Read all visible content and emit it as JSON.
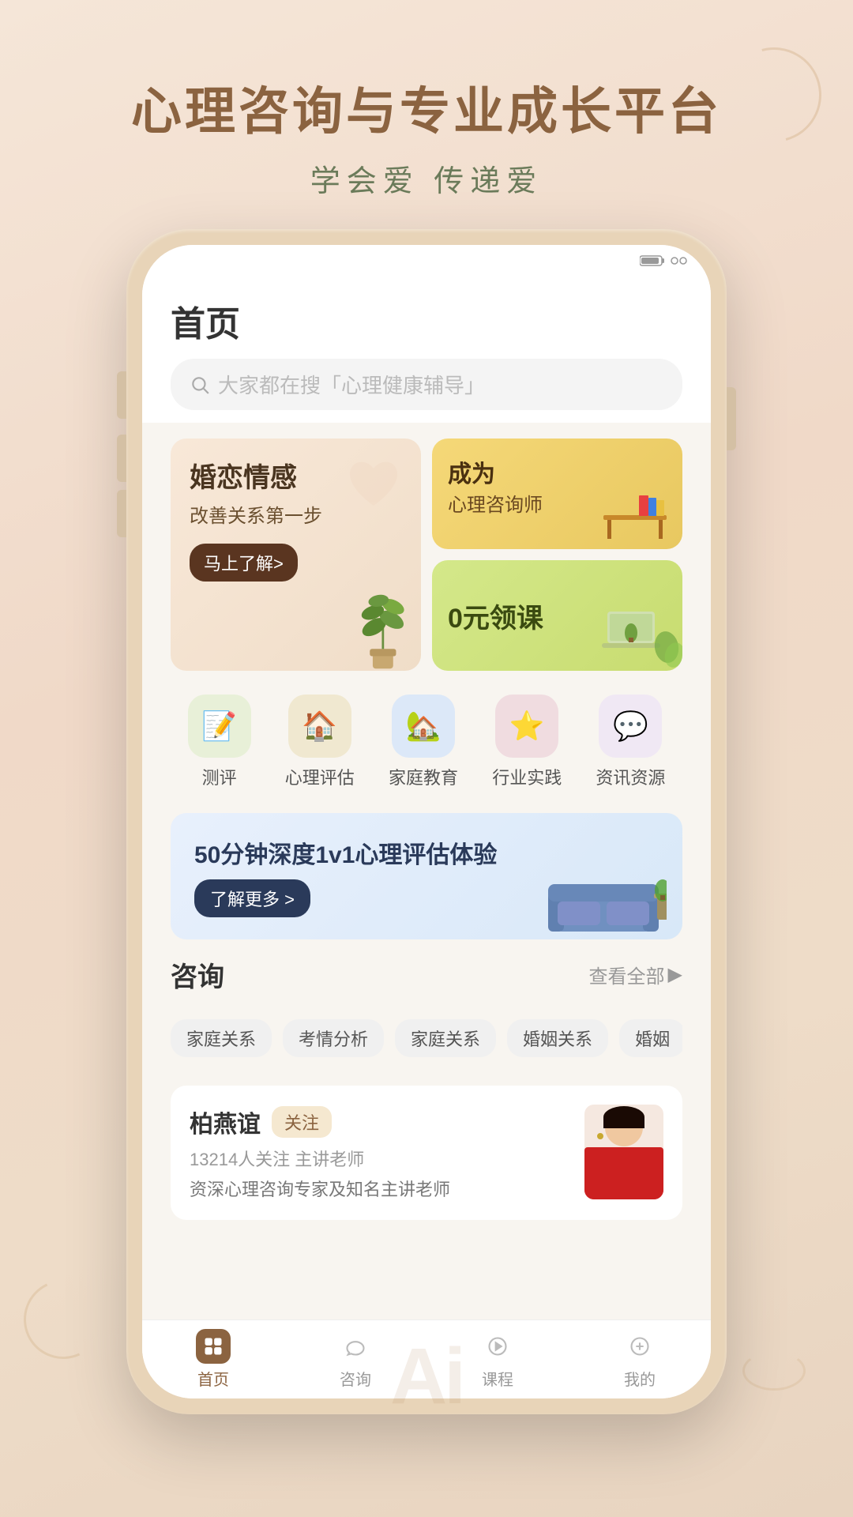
{
  "app": {
    "name": "心理咨询与专业成长平台",
    "tagline": "学会爱  传递爱"
  },
  "header": {
    "title": "首页",
    "search_placeholder": "大家都在搜「心理健康辅导」"
  },
  "banners": [
    {
      "id": "banner_marriage",
      "title": "婚恋情感",
      "subtitle": "改善关系第一步",
      "btn_label": "马上了解>"
    },
    {
      "id": "banner_counselor",
      "title": "成为",
      "subtitle": "心理咨询师"
    },
    {
      "id": "banner_free",
      "title": "0元领课"
    }
  ],
  "quick_nav": [
    {
      "id": "nav_assessment",
      "label": "测评",
      "icon": "📝",
      "color": "#e8f0e0"
    },
    {
      "id": "nav_psych_eval",
      "label": "心理评估",
      "icon": "🏠",
      "color": "#f0e8d0"
    },
    {
      "id": "nav_family_edu",
      "label": "家庭教育",
      "icon": "🏡",
      "color": "#e0eaf8"
    },
    {
      "id": "nav_industry",
      "label": "行业实践",
      "icon": "⭐",
      "color": "#f0e0e0"
    },
    {
      "id": "nav_info",
      "label": "资讯资源",
      "icon": "💬",
      "color": "#f0e8f0"
    }
  ],
  "promo": {
    "title": "50分钟深度1v1心理评估体验",
    "btn_label": "了解更多 >"
  },
  "consult_section": {
    "title": "咨询",
    "more_label": "查看全部",
    "tags": [
      "家庭关系",
      "考情分析",
      "家庭关系",
      "婚姻关系",
      "婚姻"
    ],
    "consultants": [
      {
        "name": "柏燕谊",
        "follow_label": "关注",
        "stats": "13214人关注  主讲老师",
        "desc": "资深心理咨询专家及知名主讲老师"
      }
    ]
  },
  "bottom_nav": [
    {
      "id": "nav_home",
      "label": "首页",
      "active": true
    },
    {
      "id": "nav_consult",
      "label": "咨询",
      "active": false
    },
    {
      "id": "nav_course",
      "label": "课程",
      "active": false
    },
    {
      "id": "nav_mine",
      "label": "我的",
      "active": false
    }
  ],
  "ai_label": "Ai",
  "colors": {
    "primary": "#8B6340",
    "bg": "#f5e6d8",
    "active_nav": "#8B6340"
  }
}
